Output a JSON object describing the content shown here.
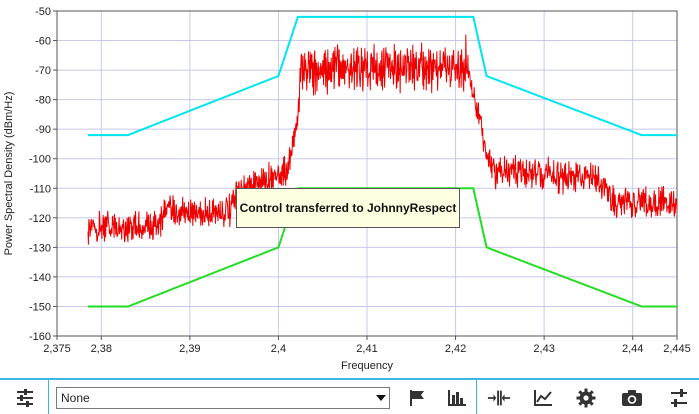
{
  "chart_data": {
    "type": "line",
    "xlabel": "Frequency",
    "ylabel": "Power Spectral Density (dBm/Hz)",
    "xlim": [
      2.375,
      2.445
    ],
    "ylim": [
      -160,
      -50
    ],
    "x_ticks": [
      "2,375",
      "2,38",
      "2,39",
      "2,4",
      "2,41",
      "2,42",
      "2,43",
      "2,44",
      "2,445"
    ],
    "x_tick_values": [
      2.375,
      2.38,
      2.39,
      2.4,
      2.41,
      2.42,
      2.43,
      2.44,
      2.445
    ],
    "y_ticks": [
      "-50",
      "-60",
      "-70",
      "-80",
      "-90",
      "-100",
      "-110",
      "-120",
      "-130",
      "-140",
      "-150",
      "-160"
    ],
    "y_tick_values": [
      -50,
      -60,
      -70,
      -80,
      -90,
      -100,
      -110,
      -120,
      -130,
      -140,
      -150,
      -160
    ],
    "grid": true,
    "series": [
      {
        "color": "#00e5ee",
        "x": [
          2.3785,
          2.383,
          2.4,
          2.4022,
          2.422,
          2.4235,
          2.441,
          2.445
        ],
        "y": [
          -92,
          -92,
          -72,
          -52,
          -52,
          -72,
          -92,
          -92
        ]
      },
      {
        "color": "#22dd22",
        "x": [
          2.3785,
          2.383,
          2.4,
          2.4022,
          2.422,
          2.4235,
          2.441,
          2.445
        ],
        "y": [
          -150,
          -150,
          -130,
          -110,
          -110,
          -130,
          -150,
          -150
        ]
      },
      {
        "color": "#ee0000",
        "x_start": 2.3785,
        "x_end": 2.445,
        "envelope": {
          "x": [
            2.3785,
            2.386,
            2.3875,
            2.3945,
            2.3955,
            2.398,
            2.401,
            2.4016,
            2.4022,
            2.4025,
            2.41,
            2.4202,
            2.4215,
            2.4225,
            2.4232,
            2.4245,
            2.436,
            2.438,
            2.445
          ],
          "y": [
            -123,
            -123,
            -118,
            -118,
            -112,
            -108,
            -104,
            -96,
            -88,
            -70,
            -69,
            -69,
            -72,
            -85,
            -95,
            -104,
            -107,
            -114,
            -115
          ]
        }
      }
    ]
  },
  "tooltip": {
    "text": "Control transferred to JohnnyRespect"
  },
  "toolbar": {
    "dropdown_value": "None",
    "buttons": [
      {
        "name": "marker-settings-icon",
        "x": 24
      },
      {
        "name": "flag-icon",
        "x": 416
      },
      {
        "name": "bar-chart-icon",
        "x": 456
      },
      {
        "name": "zoom-fit-icon",
        "x": 499
      },
      {
        "name": "line-chart-icon",
        "x": 543
      },
      {
        "name": "gear-icon",
        "x": 586
      },
      {
        "name": "camera-icon",
        "x": 632
      },
      {
        "name": "sliders-icon",
        "x": 679
      }
    ]
  },
  "colors": {
    "accent": "#3fb6e4",
    "grid": "#c8c8ec",
    "tooltip_bg": "#ffffe1"
  }
}
